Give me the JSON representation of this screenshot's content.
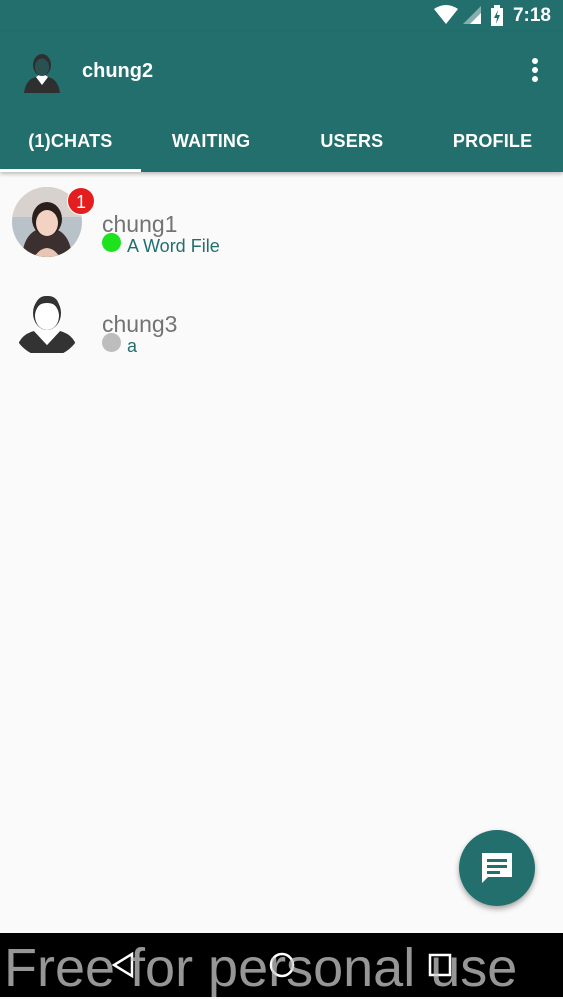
{
  "status_bar": {
    "time": "7:18",
    "icons": [
      "wifi-icon",
      "signal-icon",
      "battery-charging-icon"
    ]
  },
  "app_bar": {
    "title": "chung2",
    "menu_icon": "more-vert-icon"
  },
  "tabs": [
    {
      "label": "(1)CHATS",
      "active": true
    },
    {
      "label": "WAITING",
      "active": false
    },
    {
      "label": "USERS",
      "active": false
    },
    {
      "label": "PROFILE",
      "active": false
    }
  ],
  "chats": [
    {
      "name": "chung1",
      "message": "A Word File",
      "unread": "1",
      "status": "online",
      "status_color": "#1ee21e"
    },
    {
      "name": "chung3",
      "message": "a",
      "unread": "",
      "status": "offline",
      "status_color": "#bdbdbd"
    }
  ],
  "fab": {
    "icon": "chat-message-icon"
  },
  "nav_bar": {
    "buttons": [
      "back-icon",
      "home-icon",
      "recents-icon"
    ]
  },
  "watermark": "Free for personal use",
  "colors": {
    "primary": "#236f6d",
    "badge": "#e41e1e",
    "online": "#1ee21e",
    "offline": "#bdbdbd"
  }
}
